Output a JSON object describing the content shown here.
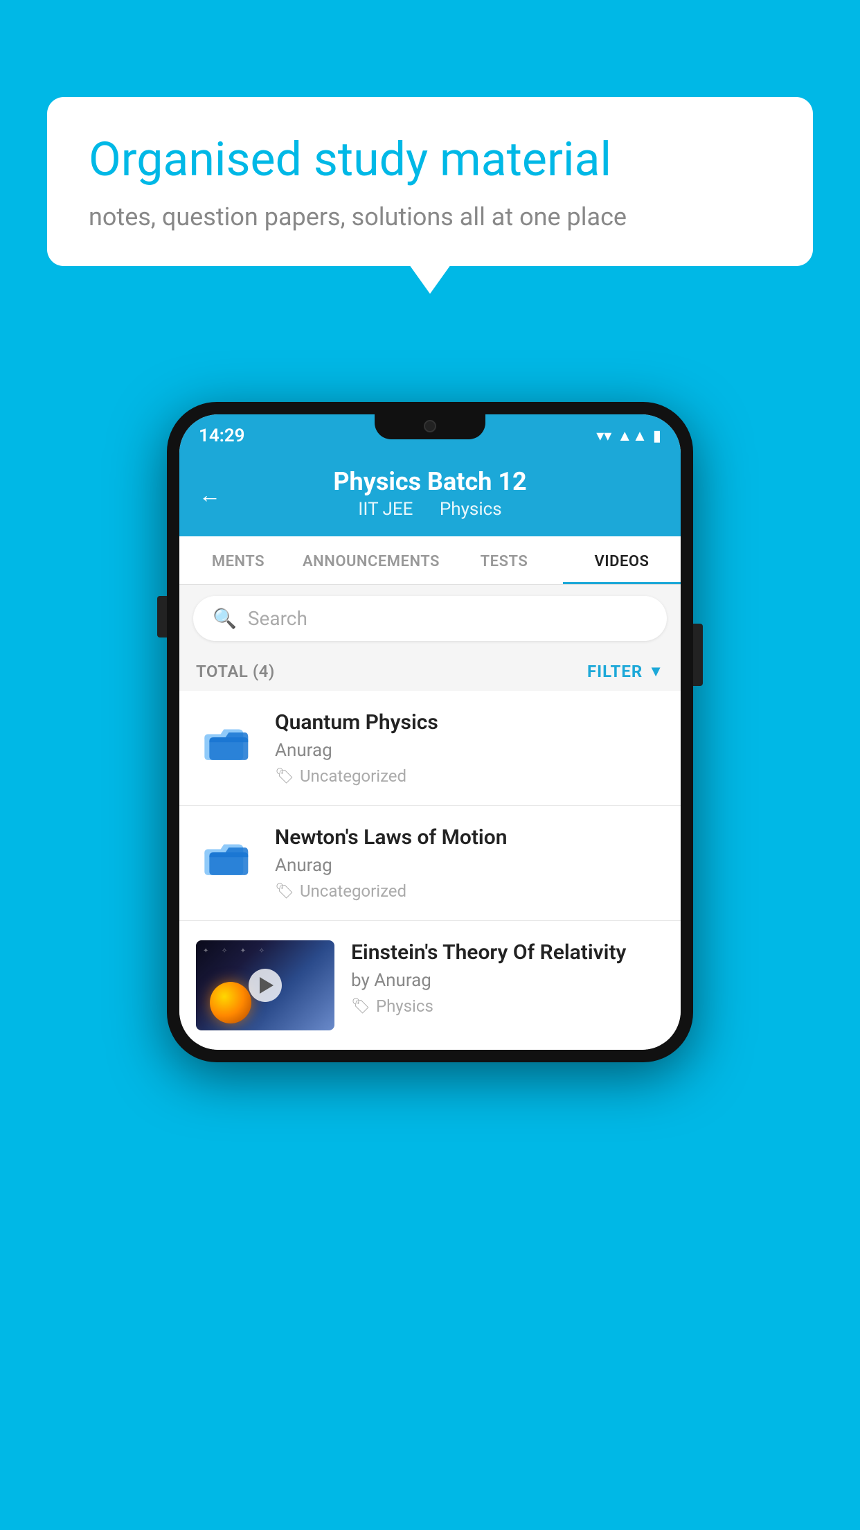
{
  "background_color": "#00b8e6",
  "speech_bubble": {
    "title": "Organised study material",
    "subtitle": "notes, question papers, solutions all at one place"
  },
  "phone": {
    "status_bar": {
      "time": "14:29",
      "wifi_icon": "wifi",
      "signal_icon": "signal",
      "battery_icon": "battery"
    },
    "header": {
      "back_label": "←",
      "title": "Physics Batch 12",
      "subtitle_part1": "IIT JEE",
      "subtitle_part2": "Physics"
    },
    "tabs": [
      {
        "label": "MENTS",
        "active": false
      },
      {
        "label": "ANNOUNCEMENTS",
        "active": false
      },
      {
        "label": "TESTS",
        "active": false
      },
      {
        "label": "VIDEOS",
        "active": true
      }
    ],
    "search": {
      "placeholder": "Search"
    },
    "filter_bar": {
      "total_label": "TOTAL (4)",
      "filter_label": "FILTER"
    },
    "videos": [
      {
        "id": 1,
        "title": "Quantum Physics",
        "author": "Anurag",
        "tag": "Uncategorized",
        "has_thumbnail": false
      },
      {
        "id": 2,
        "title": "Newton's Laws of Motion",
        "author": "Anurag",
        "tag": "Uncategorized",
        "has_thumbnail": false
      },
      {
        "id": 3,
        "title": "Einstein's Theory Of Relativity",
        "author": "by Anurag",
        "tag": "Physics",
        "has_thumbnail": true
      }
    ]
  }
}
